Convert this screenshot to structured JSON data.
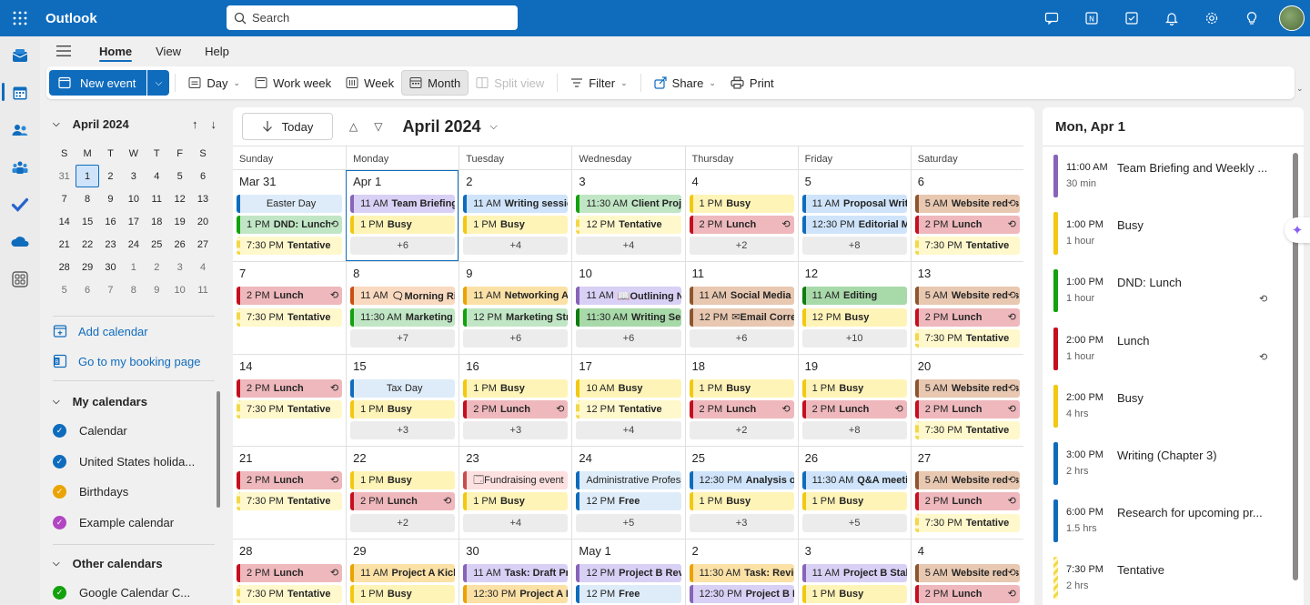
{
  "app": {
    "name": "Outlook"
  },
  "search": {
    "placeholder": "Search"
  },
  "menu": {
    "tabs": [
      "Home",
      "View",
      "Help"
    ]
  },
  "ribbon": {
    "new_event": "New event",
    "day": "Day",
    "work_week": "Work week",
    "week": "Week",
    "month": "Month",
    "split_view": "Split view",
    "filter": "Filter",
    "share": "Share",
    "print": "Print"
  },
  "minical": {
    "title": "April 2024",
    "dows": [
      "S",
      "M",
      "T",
      "W",
      "T",
      "F",
      "S"
    ],
    "weeks": [
      [
        "31",
        "1",
        "2",
        "3",
        "4",
        "5",
        "6"
      ],
      [
        "7",
        "8",
        "9",
        "10",
        "11",
        "12",
        "13"
      ],
      [
        "14",
        "15",
        "16",
        "17",
        "18",
        "19",
        "20"
      ],
      [
        "21",
        "22",
        "23",
        "24",
        "25",
        "26",
        "27"
      ],
      [
        "28",
        "29",
        "30",
        "1",
        "2",
        "3",
        "4"
      ],
      [
        "5",
        "6",
        "7",
        "8",
        "9",
        "10",
        "11"
      ]
    ]
  },
  "left": {
    "add_calendar": "Add calendar",
    "booking": "Go to my booking page",
    "my_calendars": "My calendars",
    "other_calendars": "Other calendars",
    "calendars": [
      {
        "name": "Calendar",
        "color": "#0f6cbd"
      },
      {
        "name": "United States holida...",
        "color": "#0f6cbd"
      },
      {
        "name": "Birthdays",
        "color": "#eaa300"
      },
      {
        "name": "Example calendar",
        "color": "#b146c2"
      }
    ],
    "other": [
      {
        "name": "Google Calendar C...",
        "color": "#13a10e"
      }
    ]
  },
  "main": {
    "today": "Today",
    "month_title": "April 2024",
    "dows": [
      "Sunday",
      "Monday",
      "Tuesday",
      "Wednesday",
      "Thursday",
      "Friday",
      "Saturday"
    ],
    "weeks": [
      [
        {
          "d": "Mar 31",
          "ev": [
            {
              "n": "Easter Day",
              "c": "lblue",
              "all": true
            },
            {
              "t": "1 PM",
              "n": "DND: Lunch",
              "c": "green",
              "r": true
            },
            {
              "t": "7:30 PM",
              "n": "Tentative",
              "c": "tent"
            }
          ]
        },
        {
          "d": "Apr 1",
          "sel": true,
          "ev": [
            {
              "t": "11 AM",
              "n": "Team Briefing",
              "c": "purple"
            },
            {
              "t": "1 PM",
              "n": "Busy",
              "c": "yellow"
            }
          ],
          "more": "+6"
        },
        {
          "d": "2",
          "ev": [
            {
              "t": "11 AM",
              "n": "Writing session",
              "c": "blue"
            },
            {
              "t": "1 PM",
              "n": "Busy",
              "c": "yellow"
            }
          ],
          "more": "+4"
        },
        {
          "d": "3",
          "ev": [
            {
              "t": "11:30 AM",
              "n": "Client Project",
              "c": "green"
            },
            {
              "t": "12 PM",
              "n": "Tentative",
              "c": "tent"
            }
          ],
          "more": "+4"
        },
        {
          "d": "4",
          "ev": [
            {
              "t": "1 PM",
              "n": "Busy",
              "c": "yellow"
            },
            {
              "t": "2 PM",
              "n": "Lunch",
              "c": "red",
              "r": true
            }
          ],
          "more": "+2"
        },
        {
          "d": "5",
          "ev": [
            {
              "t": "11 AM",
              "n": "Proposal Writing",
              "c": "blue"
            },
            {
              "t": "12:30 PM",
              "n": "Editorial Meeting",
              "c": "blue"
            }
          ],
          "more": "+8"
        },
        {
          "d": "6",
          "ev": [
            {
              "t": "5 AM",
              "n": "Website redesign",
              "c": "brown",
              "r": true
            },
            {
              "t": "2 PM",
              "n": "Lunch",
              "c": "red",
              "r": true
            },
            {
              "t": "7:30 PM",
              "n": "Tentative",
              "c": "tent"
            }
          ]
        }
      ],
      [
        {
          "d": "7",
          "ev": [
            {
              "t": "2 PM",
              "n": "Lunch",
              "c": "red",
              "r": true
            },
            {
              "t": "7:30 PM",
              "n": "Tentative",
              "c": "tent"
            }
          ]
        },
        {
          "d": "8",
          "ev": [
            {
              "t": "11 AM",
              "n": "🗨Morning Ritual",
              "c": "orange"
            },
            {
              "t": "11:30 AM",
              "n": "Marketing Strategy",
              "c": "green"
            }
          ],
          "more": "+7"
        },
        {
          "d": "9",
          "ev": [
            {
              "t": "11 AM",
              "n": "Networking A",
              "c": "gold"
            },
            {
              "t": "12 PM",
              "n": "Marketing Strategy",
              "c": "green"
            }
          ],
          "more": "+6"
        },
        {
          "d": "10",
          "ev": [
            {
              "t": "11 AM",
              "n": "📖Outlining N",
              "c": "purple"
            },
            {
              "t": "11:30 AM",
              "n": "Writing Session",
              "c": "ggreen"
            }
          ],
          "more": "+6"
        },
        {
          "d": "11",
          "ev": [
            {
              "t": "11 AM",
              "n": "Social Media Update",
              "c": "brown"
            },
            {
              "t": "12 PM",
              "n": "✉Email Correspondence",
              "c": "brown"
            }
          ],
          "more": "+6"
        },
        {
          "d": "12",
          "ev": [
            {
              "t": "11 AM",
              "n": "Editing",
              "c": "ggreen"
            },
            {
              "t": "12 PM",
              "n": "Busy",
              "c": "yellow"
            }
          ],
          "more": "+10"
        },
        {
          "d": "13",
          "ev": [
            {
              "t": "5 AM",
              "n": "Website redesign",
              "c": "brown",
              "r": true
            },
            {
              "t": "2 PM",
              "n": "Lunch",
              "c": "red",
              "r": true
            },
            {
              "t": "7:30 PM",
              "n": "Tentative",
              "c": "tent"
            }
          ]
        }
      ],
      [
        {
          "d": "14",
          "ev": [
            {
              "t": "2 PM",
              "n": "Lunch",
              "c": "red",
              "r": true
            },
            {
              "t": "7:30 PM",
              "n": "Tentative",
              "c": "tent"
            }
          ]
        },
        {
          "d": "15",
          "ev": [
            {
              "n": "Tax Day",
              "c": "lblue",
              "all": true
            },
            {
              "t": "1 PM",
              "n": "Busy",
              "c": "yellow"
            }
          ],
          "more": "+3"
        },
        {
          "d": "16",
          "ev": [
            {
              "t": "1 PM",
              "n": "Busy",
              "c": "yellow"
            },
            {
              "t": "2 PM",
              "n": "Lunch",
              "c": "red",
              "r": true
            }
          ],
          "more": "+3"
        },
        {
          "d": "17",
          "ev": [
            {
              "t": "10 AM",
              "n": "Busy",
              "c": "yellow"
            },
            {
              "t": "12 PM",
              "n": "Tentative",
              "c": "tent"
            }
          ],
          "more": "+4"
        },
        {
          "d": "18",
          "ev": [
            {
              "t": "1 PM",
              "n": "Busy",
              "c": "yellow"
            },
            {
              "t": "2 PM",
              "n": "Lunch",
              "c": "red",
              "r": true
            }
          ],
          "more": "+2"
        },
        {
          "d": "19",
          "ev": [
            {
              "t": "1 PM",
              "n": "Busy",
              "c": "yellow"
            },
            {
              "t": "2 PM",
              "n": "Lunch",
              "c": "red",
              "r": true
            }
          ],
          "more": "+8"
        },
        {
          "d": "20",
          "ev": [
            {
              "t": "5 AM",
              "n": "Website redesign",
              "c": "brown",
              "r": true
            },
            {
              "t": "2 PM",
              "n": "Lunch",
              "c": "red",
              "r": true
            },
            {
              "t": "7:30 PM",
              "n": "Tentative",
              "c": "tent"
            }
          ]
        }
      ],
      [
        {
          "d": "21",
          "ev": [
            {
              "t": "2 PM",
              "n": "Lunch",
              "c": "red",
              "r": true
            },
            {
              "t": "7:30 PM",
              "n": "Tentative",
              "c": "tent"
            }
          ]
        },
        {
          "d": "22",
          "ev": [
            {
              "t": "1 PM",
              "n": "Busy",
              "c": "yellow"
            },
            {
              "t": "2 PM",
              "n": "Lunch",
              "c": "red",
              "r": true
            }
          ],
          "more": "+2"
        },
        {
          "d": "23",
          "ev": [
            {
              "t": "",
              "n": "🗔Fundraising event",
              "c": "pink",
              "b": false
            },
            {
              "t": "1 PM",
              "n": "Busy",
              "c": "yellow"
            }
          ],
          "more": "+4"
        },
        {
          "d": "24",
          "ev": [
            {
              "t": "",
              "n": "Administrative Professionals Day",
              "c": "lblue",
              "b": false
            },
            {
              "t": "12 PM",
              "n": "Free",
              "c": "lblue"
            }
          ],
          "more": "+5"
        },
        {
          "d": "25",
          "ev": [
            {
              "t": "12:30 PM",
              "n": "Analysis of",
              "c": "blue"
            },
            {
              "t": "1 PM",
              "n": "Busy",
              "c": "yellow"
            }
          ],
          "more": "+3"
        },
        {
          "d": "26",
          "ev": [
            {
              "t": "11:30 AM",
              "n": "Q&A meeting",
              "c": "blue"
            },
            {
              "t": "1 PM",
              "n": "Busy",
              "c": "yellow"
            }
          ],
          "more": "+5"
        },
        {
          "d": "27",
          "ev": [
            {
              "t": "5 AM",
              "n": "Website redesign",
              "c": "brown",
              "r": true
            },
            {
              "t": "2 PM",
              "n": "Lunch",
              "c": "red",
              "r": true
            },
            {
              "t": "7:30 PM",
              "n": "Tentative",
              "c": "tent"
            }
          ]
        }
      ],
      [
        {
          "d": "28",
          "ev": [
            {
              "t": "2 PM",
              "n": "Lunch",
              "c": "red",
              "r": true
            },
            {
              "t": "7:30 PM",
              "n": "Tentative",
              "c": "tent"
            }
          ]
        },
        {
          "d": "29",
          "ev": [
            {
              "t": "11 AM",
              "n": "Project A Kickoff",
              "c": "gold"
            },
            {
              "t": "1 PM",
              "n": "Busy",
              "c": "yellow"
            }
          ]
        },
        {
          "d": "30",
          "ev": [
            {
              "t": "11 AM",
              "n": "Task: Draft Proposal",
              "c": "purple"
            },
            {
              "t": "12:30 PM",
              "n": "Project A Deadline",
              "c": "gold"
            }
          ]
        },
        {
          "d": "May 1",
          "ev": [
            {
              "t": "12 PM",
              "n": "Project B Review",
              "c": "purple"
            },
            {
              "t": "12 PM",
              "n": "Free",
              "c": "lblue"
            }
          ]
        },
        {
          "d": "2",
          "ev": [
            {
              "t": "11:30 AM",
              "n": "Task: Review",
              "c": "gold"
            },
            {
              "t": "12:30 PM",
              "n": "Project B Launch",
              "c": "purple"
            }
          ]
        },
        {
          "d": "3",
          "ev": [
            {
              "t": "11 AM",
              "n": "Project B Stakeholders",
              "c": "purple"
            },
            {
              "t": "1 PM",
              "n": "Busy",
              "c": "yellow"
            }
          ]
        },
        {
          "d": "4",
          "ev": [
            {
              "t": "5 AM",
              "n": "Website redesign",
              "c": "brown",
              "r": true
            },
            {
              "t": "2 PM",
              "n": "Lunch",
              "c": "red",
              "r": true
            }
          ]
        }
      ]
    ]
  },
  "agenda": {
    "title": "Mon, Apr 1",
    "items": [
      {
        "time": "11:00 AM",
        "dur": "30 min",
        "name": "Team Briefing and Weekly ...",
        "color": "#8764b8",
        "rep": false
      },
      {
        "time": "1:00 PM",
        "dur": "1 hour",
        "name": "Busy",
        "color": "#f2c811",
        "rep": false
      },
      {
        "time": "1:00 PM",
        "dur": "1 hour",
        "name": "DND: Lunch",
        "color": "#13a10e",
        "rep": true
      },
      {
        "time": "2:00 PM",
        "dur": "1 hour",
        "name": "Lunch",
        "color": "#c50f1f",
        "rep": true
      },
      {
        "time": "2:00 PM",
        "dur": "4 hrs",
        "name": "Busy",
        "color": "#f2c811",
        "rep": false
      },
      {
        "time": "3:00 PM",
        "dur": "2 hrs",
        "name": "Writing (Chapter 3)",
        "color": "#0f6cbd",
        "rep": false
      },
      {
        "time": "6:00 PM",
        "dur": "1.5 hrs",
        "name": "Research for upcoming pr...",
        "color": "#0f6cbd",
        "rep": false
      },
      {
        "time": "7:30 PM",
        "dur": "2 hrs",
        "name": "Tentative",
        "color": "#f2d84a",
        "rep": false
      }
    ]
  }
}
